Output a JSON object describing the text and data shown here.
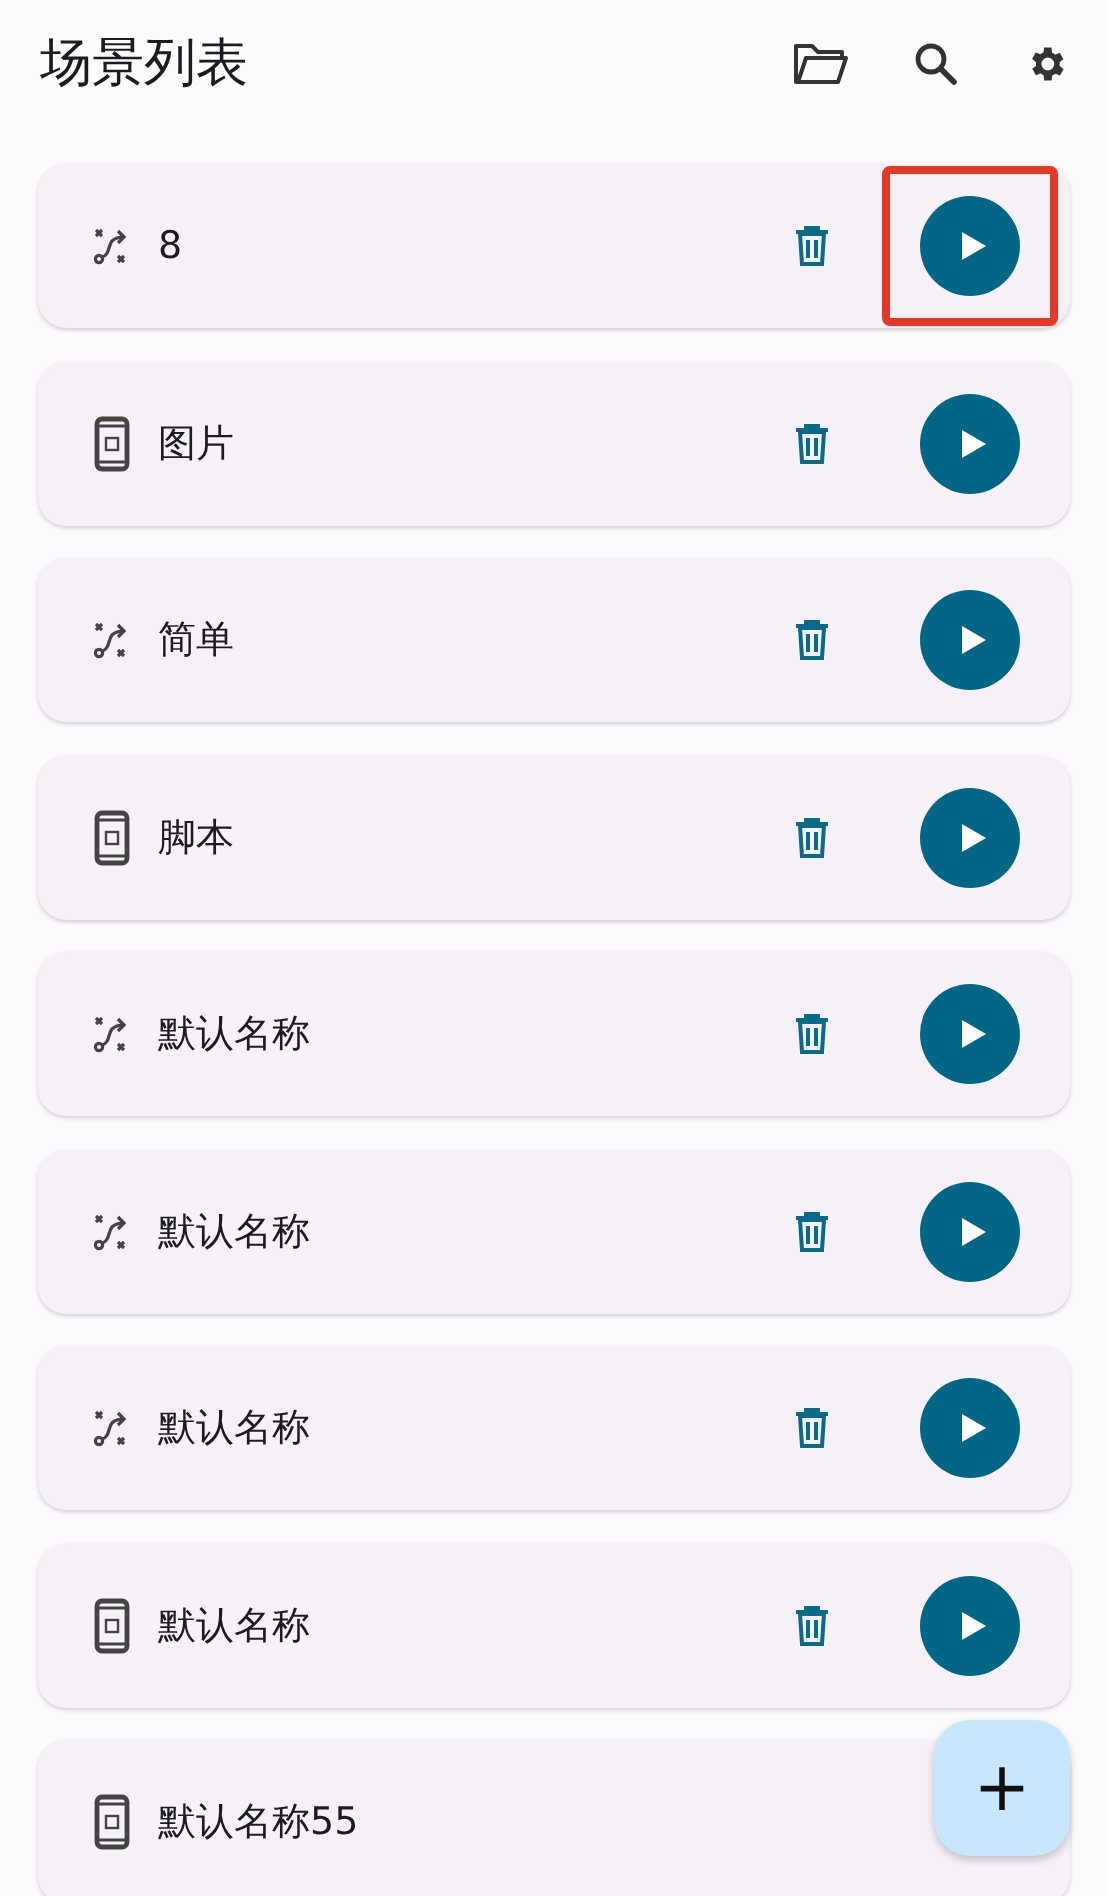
{
  "title": "场景列表",
  "scenes": [
    {
      "kind": "flow",
      "name": "8",
      "highlighted": true
    },
    {
      "kind": "phone",
      "name": "图片",
      "highlighted": false
    },
    {
      "kind": "flow",
      "name": "简单",
      "highlighted": false
    },
    {
      "kind": "phone",
      "name": "脚本",
      "highlighted": false
    },
    {
      "kind": "flow",
      "name": "默认名称",
      "highlighted": false
    },
    {
      "kind": "flow",
      "name": "默认名称",
      "highlighted": false
    },
    {
      "kind": "flow",
      "name": "默认名称",
      "highlighted": false
    },
    {
      "kind": "phone",
      "name": "默认名称",
      "highlighted": false
    },
    {
      "kind": "phone",
      "name": "默认名称55",
      "highlighted": false,
      "actions_hidden": true
    }
  ],
  "fab": {
    "label": "+"
  }
}
